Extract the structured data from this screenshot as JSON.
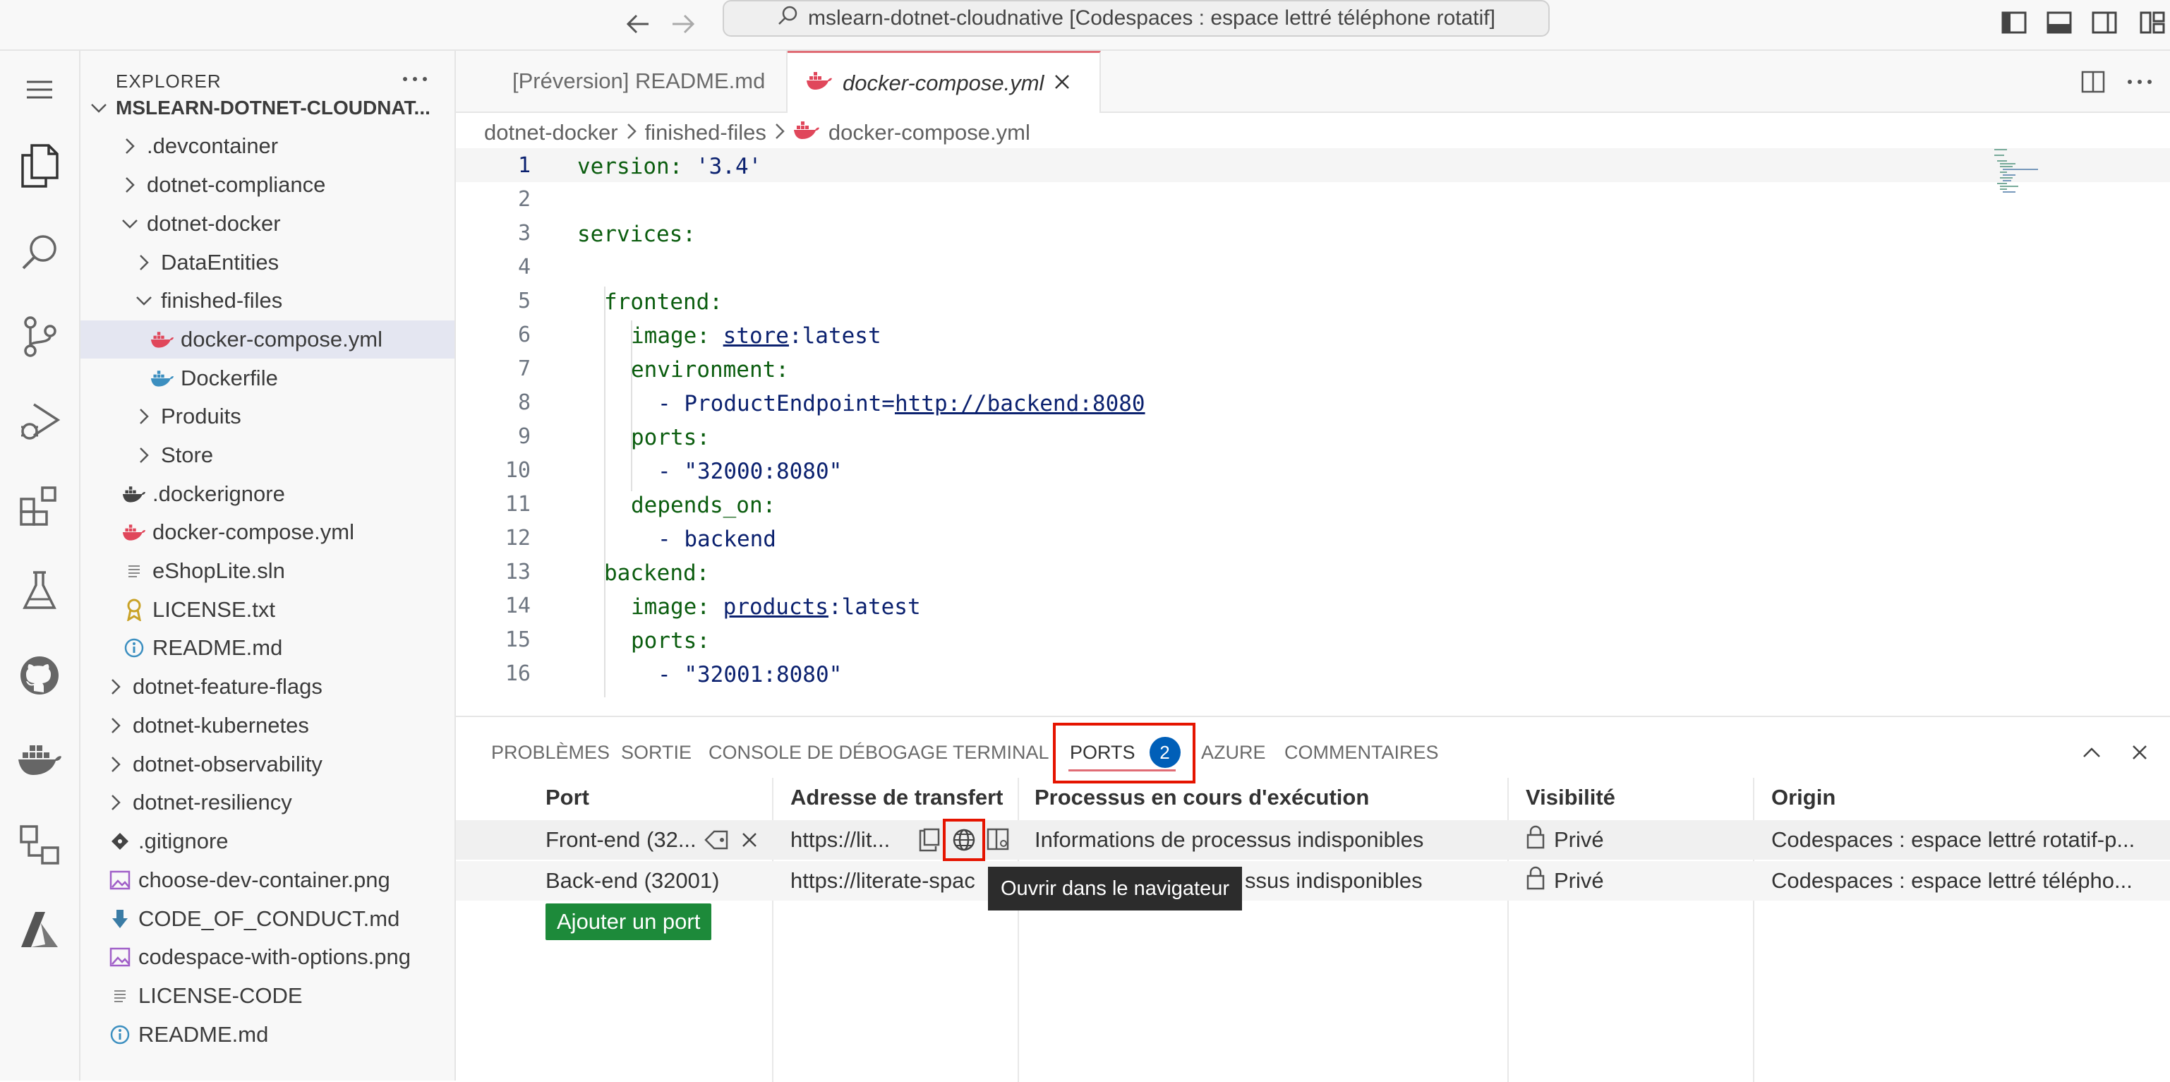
{
  "titlebar": {
    "search_text": "mslearn-dotnet-cloudnative [Codespaces : espace lettré téléphone rotatif]"
  },
  "activity_bar": [
    "menu-icon",
    "explorer-icon",
    "search-icon",
    "source-control-icon",
    "run-debug-icon",
    "extensions-icon",
    "testing-icon",
    "github-icon",
    "docker-icon",
    "remote-explorer-icon",
    "azure-icon"
  ],
  "sidebar": {
    "header": "EXPLORER",
    "root": "MSLEARN-DOTNET-CLOUDNAT...",
    "items": [
      {
        "label": ".devcontainer",
        "type": "folder"
      },
      {
        "label": "dotnet-compliance",
        "type": "folder"
      },
      {
        "label": "dotnet-docker",
        "type": "folder-open"
      },
      {
        "label": "DataEntities",
        "type": "folder"
      },
      {
        "label": "finished-files",
        "type": "folder-open"
      },
      {
        "label": "docker-compose.yml",
        "type": "docker-compose"
      },
      {
        "label": "Dockerfile",
        "type": "dockerfile"
      },
      {
        "label": "Produits",
        "type": "folder"
      },
      {
        "label": "Store",
        "type": "folder"
      },
      {
        "label": ".dockerignore",
        "type": "dockerignore"
      },
      {
        "label": "docker-compose.yml",
        "type": "docker-compose"
      },
      {
        "label": "eShopLite.sln",
        "type": "text"
      },
      {
        "label": "LICENSE.txt",
        "type": "license"
      },
      {
        "label": "README.md",
        "type": "info"
      },
      {
        "label": "dotnet-feature-flags",
        "type": "folder"
      },
      {
        "label": "dotnet-kubernetes",
        "type": "folder"
      },
      {
        "label": "dotnet-observability",
        "type": "folder"
      },
      {
        "label": "dotnet-resiliency",
        "type": "folder"
      },
      {
        "label": ".gitignore",
        "type": "git"
      },
      {
        "label": "choose-dev-container.png",
        "type": "image"
      },
      {
        "label": "CODE_OF_CONDUCT.md",
        "type": "download"
      },
      {
        "label": "codespace-with-options.png",
        "type": "image"
      },
      {
        "label": "LICENSE-CODE",
        "type": "text"
      },
      {
        "label": "README.md",
        "type": "info"
      }
    ]
  },
  "editor": {
    "tabs": [
      "[Préversion] README.md",
      "docker-compose.yml"
    ],
    "breadcrumb": [
      "dotnet-docker",
      "finished-files",
      "docker-compose.yml"
    ],
    "line_numbers": [
      "1",
      "2",
      "3",
      "4",
      "5",
      "6",
      "7",
      "8",
      "9",
      "10",
      "11",
      "12",
      "13",
      "14",
      "15",
      "16"
    ],
    "code": {
      "l1_key": "version:",
      "l1_val": "'3.4'",
      "l3_key": "services:",
      "l5_key": "frontend:",
      "l6_key": "image:",
      "l6_val_a": "store",
      "l6_val_b": ":latest",
      "l7_key": "environment:",
      "l8_val_a": "- ProductEndpoint=",
      "l8_val_b": "http://backend:8080",
      "l9_key": "ports:",
      "l10_val": "- \"32000:8080\"",
      "l11_key": "depends_on:",
      "l12_val": "- backend",
      "l13_key": "backend:",
      "l14_key": "image:",
      "l14_val_a": "products",
      "l14_val_b": ":latest",
      "l15_key": "ports:",
      "l16_val": "- \"32001:8080\""
    }
  },
  "panel": {
    "tabs": [
      "PROBLÈMES",
      "SORTIE",
      "CONSOLE DE DÉBOGAGE",
      "TERMINAL",
      "PORTS",
      "AZURE",
      "COMMENTAIRES"
    ],
    "ports_badge": "2",
    "columns": [
      "Port",
      "Adresse de transfert",
      "Processus en cours d'exécution",
      "Visibilité",
      "Origin"
    ],
    "rows": [
      {
        "port": "Front-end (32...",
        "address": "https://lit...",
        "process": "Informations de processus indisponibles",
        "visibility": "Privé",
        "origin": "Codespaces : espace lettré rotatif-p..."
      },
      {
        "port": "Back-end (32001)",
        "address": "https://literate-spac",
        "process": "ssus indisponibles",
        "visibility": "Privé",
        "origin": "Codespaces : espace lettré télépho..."
      }
    ],
    "add_port": "Ajouter un port",
    "tooltip": "Ouvrir dans le navigateur"
  }
}
